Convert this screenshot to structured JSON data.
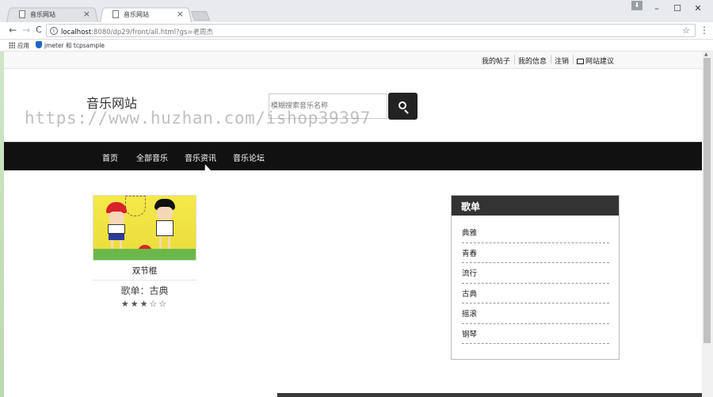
{
  "browser": {
    "tabs": [
      {
        "label": "音乐网站",
        "active": false
      },
      {
        "label": "音乐网站",
        "active": true
      }
    ],
    "close_glyph": "×",
    "window_controls": {
      "minimize": "–",
      "maximize": "☐",
      "close": "✕"
    },
    "nav": {
      "back": "←",
      "forward": "→",
      "reload": "C"
    },
    "address": {
      "host": "localhost",
      "path": ":8080/dp29/front/all.html?gs=老周杰"
    },
    "bookmarks": [
      {
        "label": "应用",
        "icon": "apps-icon"
      },
      {
        "label": "jmeter 和 tcpsample",
        "icon": "shield-icon"
      }
    ]
  },
  "topbar": {
    "links": [
      "我的帖子",
      "我的信息",
      "注销",
      "网站建议"
    ]
  },
  "header": {
    "site_title": "音乐网站",
    "search_placeholder": "模糊搜索音乐名称",
    "watermark": "https://www.huzhan.com/ishop39397"
  },
  "nav": {
    "items": [
      "首页",
      "全部音乐",
      "音乐资讯",
      "音乐论坛"
    ]
  },
  "card": {
    "title": "双节棍",
    "subtitle": "歌单：古典",
    "stars": "★★★☆☆",
    "rating": 3,
    "rating_max": 5
  },
  "playlist": {
    "title": "歌单",
    "items": [
      "典雅",
      "青春",
      "流行",
      "古典",
      "摇滚",
      "钢琴"
    ]
  },
  "colors": {
    "navbar_bg": "#111111",
    "playlist_header_bg": "#333333",
    "search_button_bg": "#222222"
  }
}
